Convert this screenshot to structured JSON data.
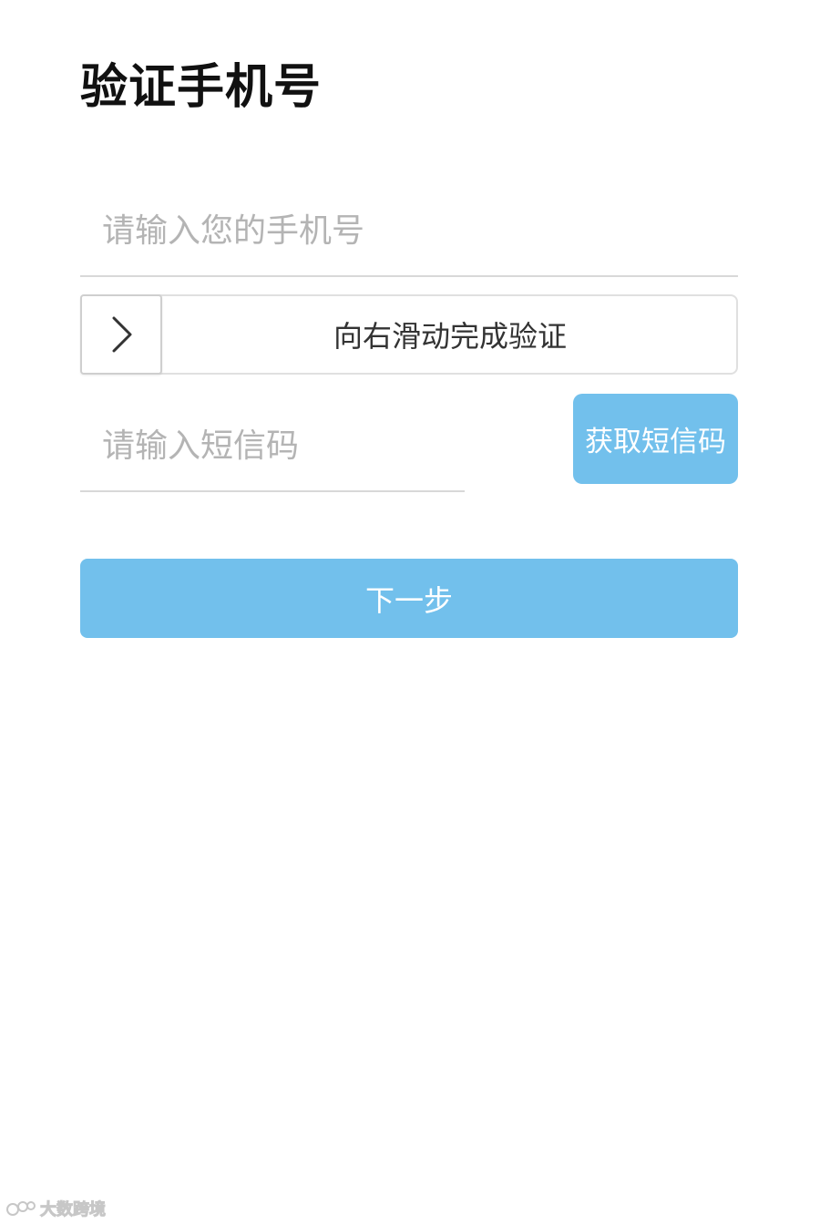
{
  "page": {
    "title": "验证手机号"
  },
  "phone_input": {
    "value": "",
    "placeholder": "请输入您的手机号"
  },
  "slider": {
    "handle_icon": "chevron-right-icon",
    "label": "向右滑动完成验证",
    "progress": 0
  },
  "sms_code_input": {
    "value": "",
    "placeholder": "请输入短信码"
  },
  "sms_button": {
    "label": "获取短信码"
  },
  "next_button": {
    "label": "下一步"
  },
  "watermark": {
    "icon": "brand-logo-icon",
    "text": "大数跨境"
  },
  "colors": {
    "accent": "#72c0ec",
    "title_text": "#111111",
    "placeholder_text": "#b4b4b4",
    "divider": "#d8d8d8"
  }
}
